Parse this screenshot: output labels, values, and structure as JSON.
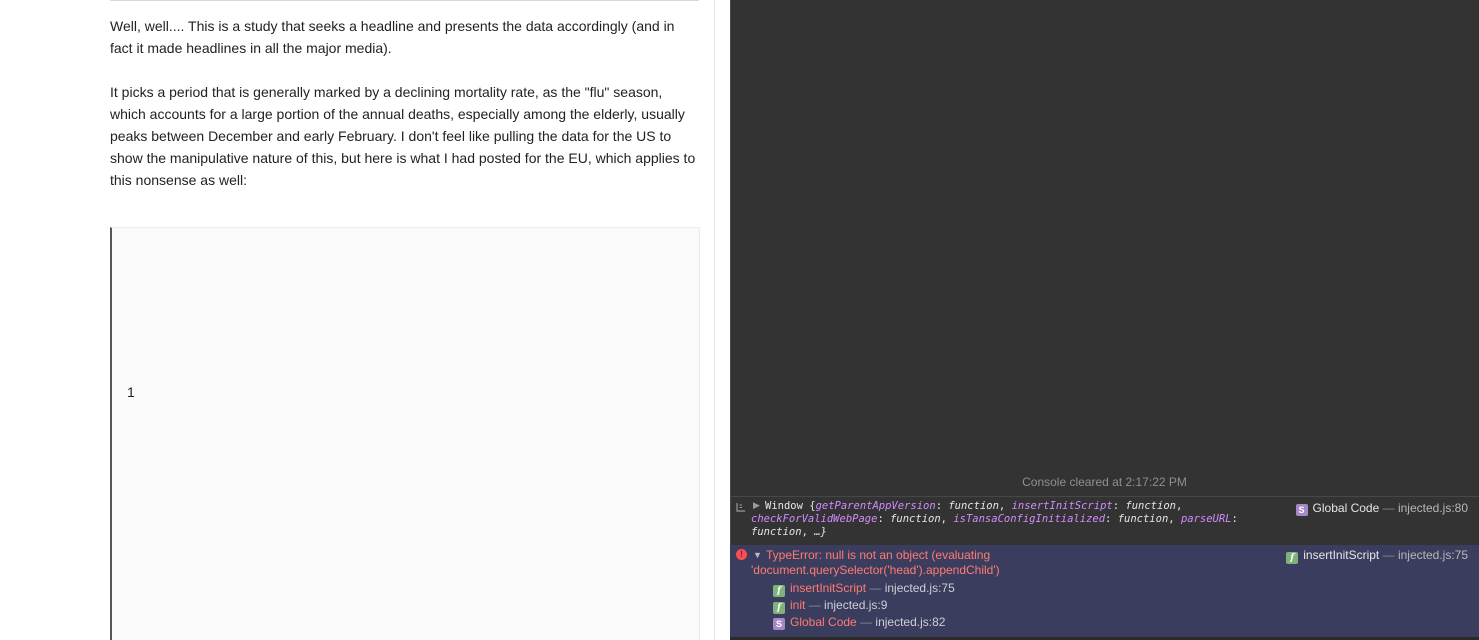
{
  "article": {
    "paragraph_1": "Well, well....  This is a study that seeks a headline and presents the data accordingly (and in fact it made headlines in all the major media).",
    "paragraph_2": "It picks a period that is generally marked by a declining mortality rate, as the \"flu\" season, which accounts for a large portion of the annual deaths, especially among the elderly, usually peaks between December and early February.  I don't feel like pulling the data for the US to show the manipulative nature of this, but here is what I had posted for the EU, which applies to this nonsense as well:",
    "embed_number": "1"
  },
  "console": {
    "cleared_message": "Console cleared at 2:17:22 PM",
    "log": {
      "prefix": "Window {",
      "props": [
        {
          "name": "getParentAppVersion",
          "value": "function"
        },
        {
          "name": "insertInitScript",
          "value": "function"
        },
        {
          "name": "checkForValidWebPage",
          "value": "function"
        },
        {
          "name": "isTansaConfigInitialized",
          "value": "function"
        },
        {
          "name": "parseURL",
          "value": "function"
        }
      ],
      "suffix": "…}",
      "source_badge": "S",
      "source_name": "Global Code",
      "source_location": "injected.js:80"
    },
    "error": {
      "message": "TypeError: null is not an object (evaluating 'document.querySelector('head').appendChild')",
      "source_badge": "f",
      "source_name": "insertInitScript",
      "source_location": "injected.js:75",
      "stack": [
        {
          "badge": "f",
          "name": "insertInitScript",
          "location": "injected.js:75"
        },
        {
          "badge": "f",
          "name": "init",
          "location": "injected.js:9"
        },
        {
          "badge": "S",
          "name": "Global Code",
          "location": "injected.js:82"
        }
      ]
    },
    "separator": "—"
  },
  "colors": {
    "console_background": "#333333",
    "error_background": "#3b3d5e",
    "error_text": "#ff7b72",
    "property_name": "#d28bff",
    "function_badge": "#7fb27b",
    "global_code_badge": "#a688c9"
  }
}
